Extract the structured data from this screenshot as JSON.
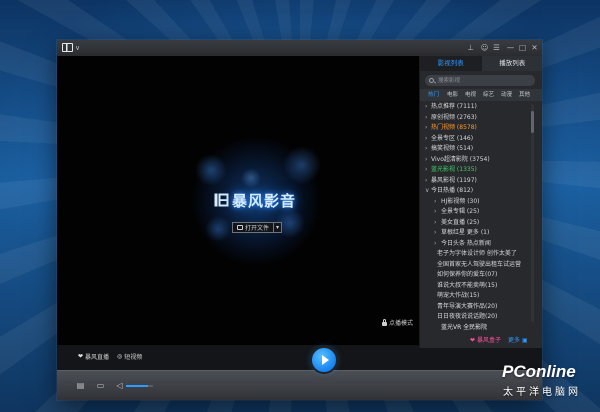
{
  "theme": {
    "accent": "#2f9bff",
    "pink": "#ff4f9a"
  },
  "titlebar": {
    "logo_icon": "player-logo-icon",
    "menu_caret": "∨",
    "controls": [
      {
        "icon": "pin-icon",
        "glyph": "⊥"
      },
      {
        "icon": "user-icon",
        "glyph": "☺"
      },
      {
        "icon": "menu-icon",
        "glyph": "☰"
      },
      {
        "icon": "minimize-icon",
        "glyph": "—"
      },
      {
        "icon": "maximize-icon",
        "glyph": "□"
      },
      {
        "icon": "close-icon",
        "glyph": "✕"
      }
    ]
  },
  "video": {
    "logo_icon": "storm-logo-icon",
    "logo_text": "暴风影音",
    "open_button": {
      "icon": "folder-icon",
      "label": "打开文件",
      "caret": "▾"
    },
    "mode": {
      "icon": "lock-icon",
      "label": "点播模式"
    }
  },
  "subbar": {
    "items": [
      {
        "icon": "heart-icon",
        "glyph": "❤",
        "label": "暴风直播"
      },
      {
        "icon": "target-icon",
        "glyph": "◎",
        "label": "短视频"
      }
    ]
  },
  "panel": {
    "tabs": [
      {
        "label": "影视列表",
        "active": true
      },
      {
        "label": "播放列表",
        "active": false
      }
    ],
    "search": {
      "icon": "search-icon",
      "placeholder": "搜索影视"
    },
    "categories": [
      "热门",
      "电影",
      "电视",
      "综艺",
      "动漫",
      "其他"
    ],
    "active_category": 0,
    "list": [
      {
        "arrow": "›",
        "label": "热点推荐 (7111)"
      },
      {
        "arrow": "›",
        "label": "原创视频 (2763)"
      },
      {
        "arrow": "›",
        "label": "热门视频 (8578)",
        "color": "#ff9a2e"
      },
      {
        "arrow": "›",
        "label": "全景专区 (146)"
      },
      {
        "arrow": "›",
        "label": "搞笑视频 (514)"
      },
      {
        "arrow": "›",
        "label": "Vivo超清影院 (3754)"
      },
      {
        "arrow": "›",
        "label": "蓝光影视 (1335)",
        "color": "#43d26a"
      },
      {
        "arrow": "›",
        "label": "暴风影视 (1197)"
      },
      {
        "arrow": "∨",
        "label": "今日热播 (812)"
      },
      {
        "arrow": "›",
        "label": "HJ影视频 (30)"
      },
      {
        "arrow": "›",
        "label": "全景专辑 (25)"
      },
      {
        "arrow": "›",
        "label": "美女直播 (25)"
      },
      {
        "arrow": "›",
        "label": "草根红星 更多 (1)"
      },
      {
        "arrow": "›",
        "label": "今日头条 热点新闻"
      },
      {
        "label": "老子为字体设计师 创作太美了"
      },
      {
        "label": "全国首家无人驾驶出租车试运营"
      },
      {
        "label": "如何保养你的爱车(07)"
      },
      {
        "label": "谁说大叔不能卖萌(15)"
      },
      {
        "label": "萌宠大作战(15)"
      },
      {
        "label": "青年导演大赛作品(20)"
      },
      {
        "label": "日日夜夜说说话题(20)"
      }
    ],
    "footer_text": "蓝光VR 全民影院",
    "footer_links": [
      {
        "icon": "heart-icon",
        "glyph": "❤",
        "label": "暴风盒子"
      },
      {
        "icon": "grid-icon",
        "glyph": "▣",
        "label": "更多"
      }
    ]
  },
  "controls": {
    "play_icon": "play-icon",
    "list_icon": {
      "icon": "playlist-icon",
      "glyph": "▤"
    },
    "folder_icon": {
      "icon": "folder-open-icon",
      "glyph": "▭"
    },
    "volume_icon": {
      "icon": "volume-icon",
      "glyph": "◁"
    },
    "volume_level": 0.8
  },
  "watermark": {
    "brand": "PConline",
    "cn": "太平洋电脑网"
  }
}
